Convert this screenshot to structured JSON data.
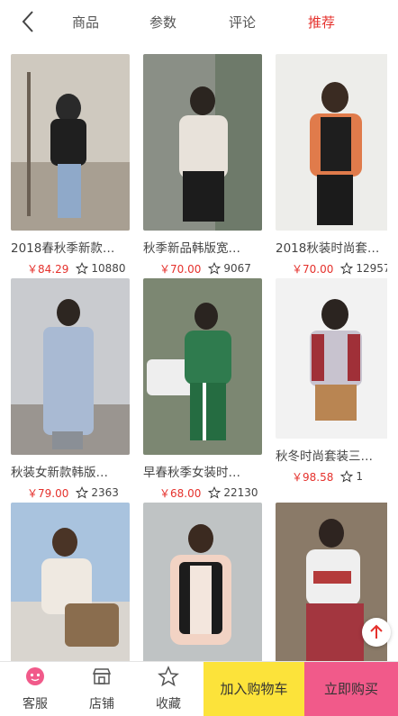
{
  "nav": {
    "tabs": [
      {
        "label": "商品"
      },
      {
        "label": "参数"
      },
      {
        "label": "评论"
      },
      {
        "label": "推荐"
      }
    ],
    "active_tab": "推荐",
    "accent_color": "#e5312c"
  },
  "products": [
    {
      "title": "2018春秋季新款…",
      "price": "￥84.29",
      "count": "10880"
    },
    {
      "title": "秋季新品韩版宽…",
      "price": "￥70.00",
      "count": "9067"
    },
    {
      "title": "2018秋装时尚套…",
      "price": "￥70.00",
      "count": "12957"
    },
    {
      "title": "秋装女新款韩版…",
      "price": "￥79.00",
      "count": "2363"
    },
    {
      "title": "早春秋季女装时…",
      "price": "￥68.00",
      "count": "22130"
    },
    {
      "title": "秋冬时尚套装三…",
      "price": "￥98.58",
      "count": "1"
    },
    {
      "title": "",
      "price": "",
      "count": ""
    },
    {
      "title": "",
      "price": "",
      "count": ""
    },
    {
      "title": "",
      "price": "",
      "count": ""
    }
  ],
  "bottom_bar": {
    "service_label": "客服",
    "shop_label": "店铺",
    "favorite_label": "收藏",
    "cart_label": "加入购物车",
    "buy_label": "立即购买",
    "cart_color": "#fce33a",
    "buy_color": "#f15a8a"
  }
}
